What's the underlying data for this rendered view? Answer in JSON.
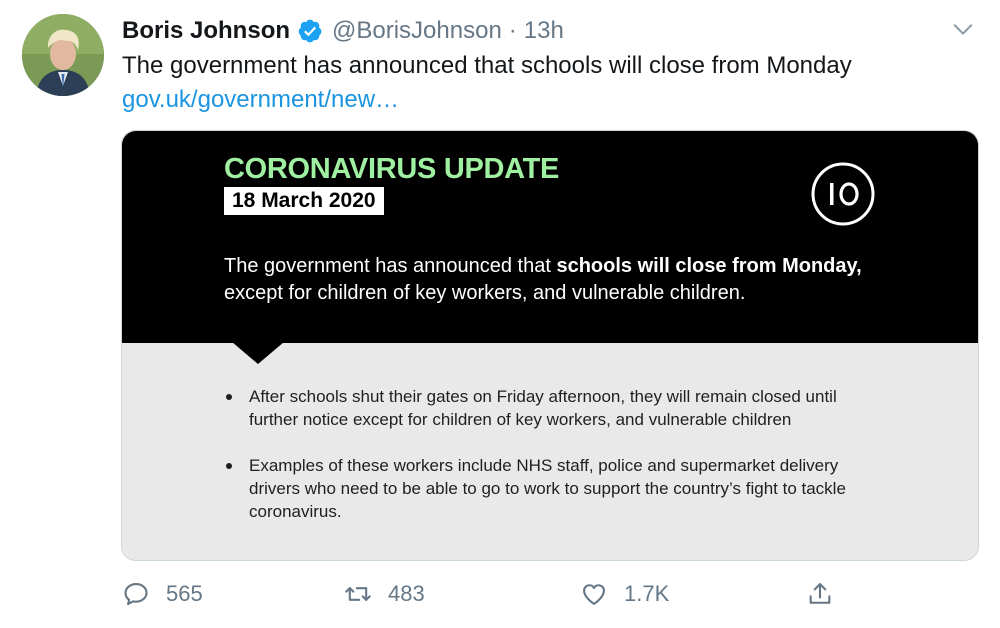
{
  "tweet": {
    "display_name": "Boris Johnson",
    "handle": "@BorisJohnson",
    "separator": "·",
    "time": "13h",
    "text": "The government has announced that schools will close from Monday",
    "link": "gov.uk/government/new…"
  },
  "card": {
    "title": "CORONAVIRUS UPDATE",
    "date": "18 March 2020",
    "logo_text": "10",
    "intro_plain_1": "The government has announced that ",
    "intro_bold_1": "schools will close from Monday,",
    "intro_plain_2": " except for children of key workers, and vulnerable children.",
    "bullets": [
      "After schools shut their gates on Friday afternoon, they will remain closed until further notice except for children of key workers, and vulnerable children",
      "Examples of these workers include NHS staff, police and supermarket delivery drivers who need to be able to go to work to support the country’s fight to tackle coronavirus."
    ]
  },
  "actions": {
    "reply_count": "565",
    "retweet_count": "483",
    "like_count": "1.7K"
  },
  "icons": {
    "verified": "verified-badge-icon",
    "more": "chevron-down-icon",
    "reply": "reply-icon",
    "retweet": "retweet-icon",
    "like": "heart-icon",
    "share": "share-icon"
  },
  "colors": {
    "link": "#1b95e0",
    "verified": "#1da1f2",
    "title_green": "#9ff0a0",
    "muted": "#657786"
  }
}
